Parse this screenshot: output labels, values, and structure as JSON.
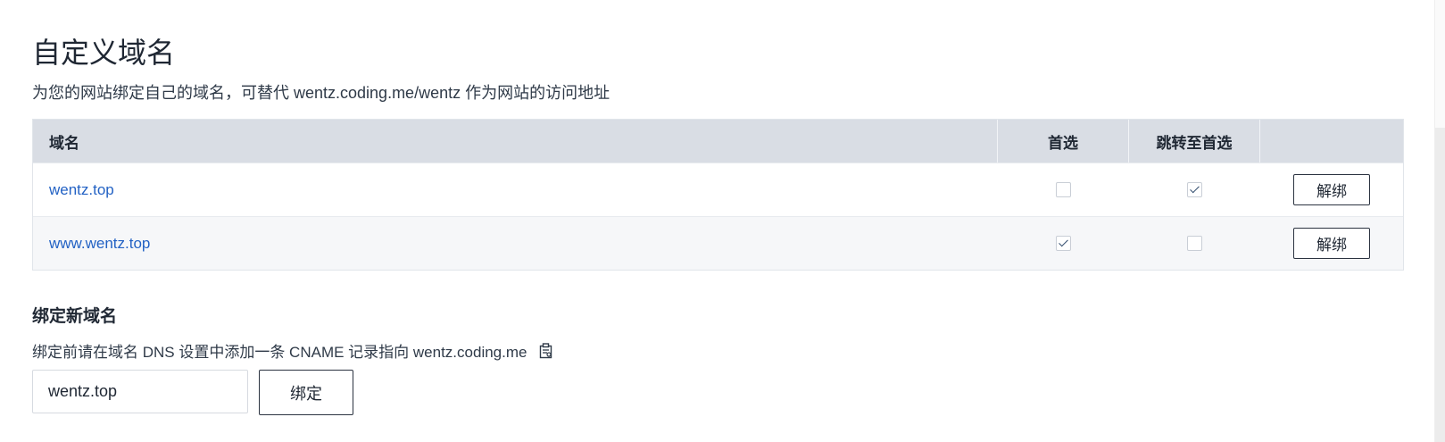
{
  "header": {
    "title": "自定义域名",
    "subtitle": "为您的网站绑定自己的域名，可替代 wentz.coding.me/wentz 作为网站的访问地址"
  },
  "table": {
    "columns": [
      "域名",
      "首选",
      "跳转至首选",
      ""
    ],
    "rows": [
      {
        "domain": "wentz.top",
        "preferred": false,
        "redirect": true,
        "action": "解绑"
      },
      {
        "domain": "www.wentz.top",
        "preferred": true,
        "redirect": false,
        "action": "解绑"
      }
    ]
  },
  "bind": {
    "title": "绑定新域名",
    "hint": "绑定前请在域名 DNS 设置中添加一条 CNAME 记录指向 wentz.coding.me",
    "hint_icon": "copy-icon",
    "input_value": "wentz.top",
    "button_label": "绑定"
  }
}
